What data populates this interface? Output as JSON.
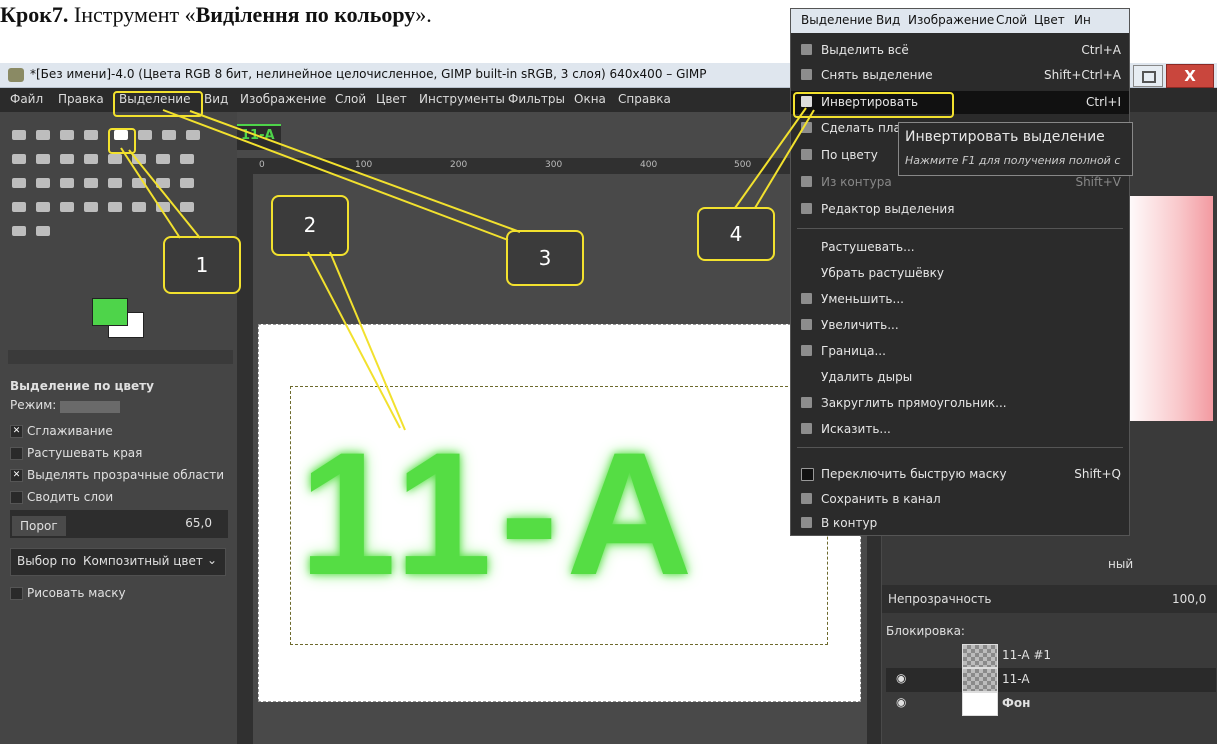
{
  "heading": {
    "step": "Крок7.",
    "mid": " Інструмент «",
    "tool": "Виділення по кольору",
    "end": "»."
  },
  "window": {
    "title": "*[Без имени]-4.0 (Цвета RGB 8 бит, нелинейное целочисленное, GIMP built-in sRGB, 3 слоя) 640x400 – GIMP",
    "close_label": "X"
  },
  "menubar": [
    "Файл",
    "Правка",
    "Выделение",
    "Вид",
    "Изображение",
    "Слой",
    "Цвет",
    "Инструменты",
    "Фильтры",
    "Окна",
    "Справка"
  ],
  "tool_options": {
    "title": "Выделение по цвету",
    "mode_label": "Режим:",
    "antialias": "Сглаживание",
    "feather": "Растушевать края",
    "select_transparent": "Выделять прозрачные области",
    "sample_merged": "Сводить слои",
    "threshold_label": "Порог",
    "threshold_value": "65,0",
    "select_by_label": "Выбор по",
    "select_by_value": "Композитный цвет",
    "draw_mask": "Рисовать маску"
  },
  "image": {
    "tab_label": "11-A",
    "canvas_text": "11-A"
  },
  "rulers": {
    "top": [
      "0",
      "100",
      "200",
      "300",
      "400",
      "500"
    ]
  },
  "dropdown": {
    "menubar": [
      "Выделение",
      "Вид",
      "Изображение",
      "Слой",
      "Цвет",
      "Ин"
    ],
    "items": [
      {
        "label": "Выделить всё",
        "shortcut": "Ctrl+A"
      },
      {
        "label": "Снять выделение",
        "shortcut": "Shift+Ctrl+A"
      },
      {
        "label": "Инвертировать",
        "shortcut": "Ctrl+I"
      },
      {
        "label": "Сделать пла",
        "shortcut": ""
      },
      {
        "label": "По цвету",
        "shortcut": ""
      },
      {
        "label": "Из контура",
        "shortcut": "Shift+V"
      },
      {
        "label": "Редактор выделения",
        "shortcut": ""
      },
      {
        "label": "Растушевать...",
        "shortcut": ""
      },
      {
        "label": "Убрать растушёвку",
        "shortcut": ""
      },
      {
        "label": "Уменьшить...",
        "shortcut": ""
      },
      {
        "label": "Увеличить...",
        "shortcut": ""
      },
      {
        "label": "Граница...",
        "shortcut": ""
      },
      {
        "label": "Удалить дыры",
        "shortcut": ""
      },
      {
        "label": "Закруглить прямоугольник...",
        "shortcut": ""
      },
      {
        "label": "Исказить...",
        "shortcut": ""
      },
      {
        "label": "Переключить быструю маску",
        "shortcut": "Shift+Q"
      },
      {
        "label": "Сохранить в канал",
        "shortcut": ""
      },
      {
        "label": "В контур",
        "shortcut": ""
      }
    ]
  },
  "tooltip": {
    "title": "Инвертировать выделение",
    "hint": "Нажмите F1 для получения полной с"
  },
  "layers": {
    "mode_fragment": "ный",
    "opacity_label": "Непрозрачность",
    "opacity_value": "100,0",
    "lock_label": "Блокировка:",
    "rows": [
      {
        "name": "11-A #1",
        "visible": false
      },
      {
        "name": "11-A",
        "visible": true
      },
      {
        "name": "Фон",
        "visible": true
      }
    ]
  },
  "callouts": [
    "1",
    "2",
    "3",
    "4"
  ],
  "colors": {
    "accent_yellow": "#f2e12e",
    "fg_green": "#4ed44a",
    "gimp_dark": "#3b3b3b"
  }
}
